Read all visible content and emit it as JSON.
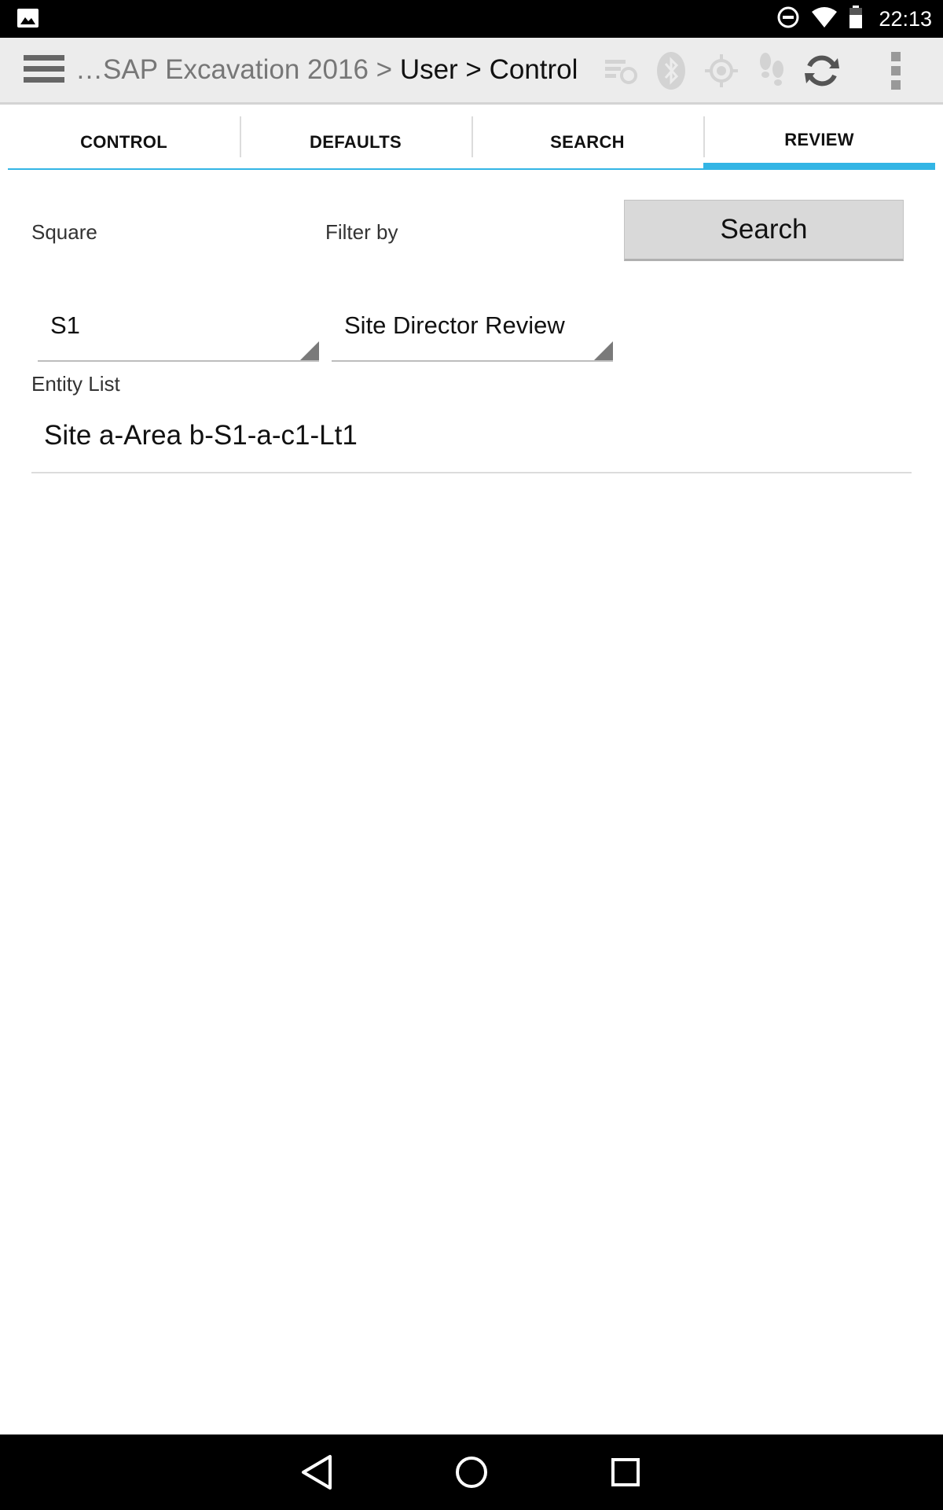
{
  "status_bar": {
    "time": "22:13"
  },
  "action_bar": {
    "title_prefix": "…SAP Excavation 2016 > ",
    "title_current": "User > Control",
    "icons": [
      "menu-icon",
      "sync-queue-icon",
      "bluetooth-icon",
      "gps-icon",
      "footsteps-icon",
      "refresh-icon",
      "overflow-icon"
    ]
  },
  "tabs": [
    {
      "label": "CONTROL",
      "active": false
    },
    {
      "label": "DEFAULTS",
      "active": false
    },
    {
      "label": "SEARCH",
      "active": false
    },
    {
      "label": "REVIEW",
      "active": true
    }
  ],
  "form": {
    "square_label": "Square",
    "filter_label": "Filter by",
    "search_button": "Search",
    "square_value": "S1",
    "filter_value": "Site Director Review",
    "entity_list_label": "Entity List",
    "entity_items": [
      "Site a-Area b-S1-a-c1-Lt1"
    ]
  },
  "colors": {
    "accent": "#33b5e5",
    "action_bar_bg": "#ececec"
  }
}
